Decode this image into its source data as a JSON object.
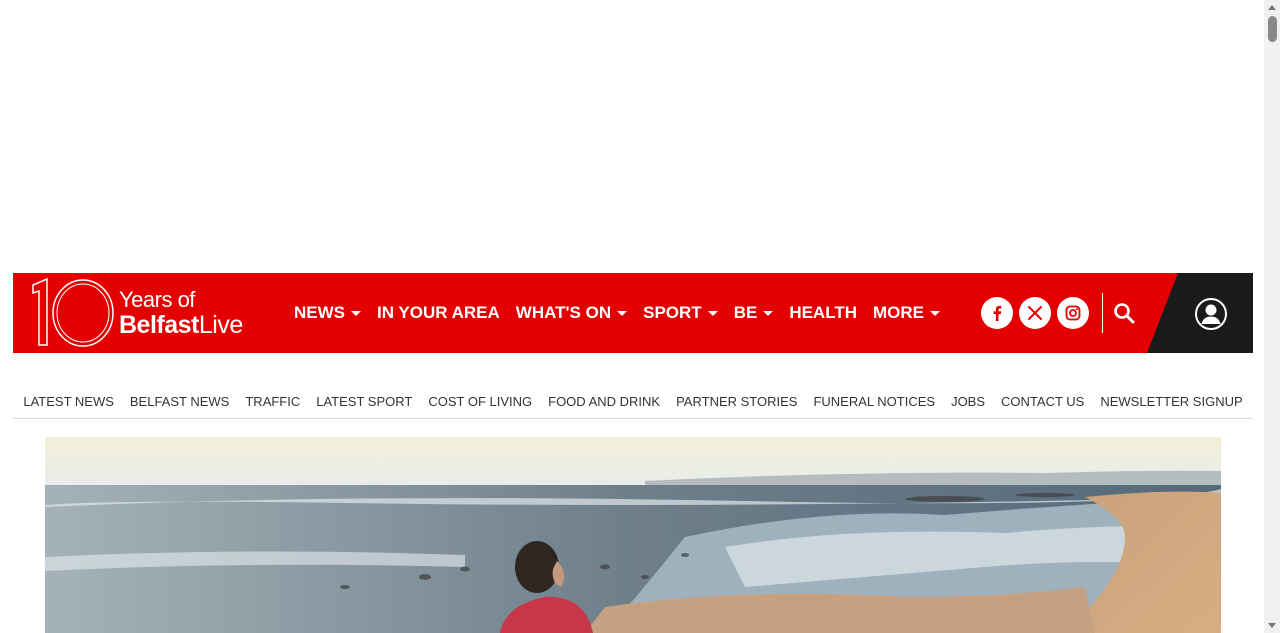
{
  "colors": {
    "brand_red": "#e40000",
    "account_bg": "#1a1a1a",
    "subnav_text": "#333333"
  },
  "logo": {
    "number": "10",
    "years_text": "Years of",
    "brand_bold": "Belfast",
    "brand_light": "Live"
  },
  "nav": {
    "items": [
      {
        "label": "NEWS",
        "has_dropdown": true
      },
      {
        "label": "IN YOUR AREA",
        "has_dropdown": false
      },
      {
        "label": "WHAT'S ON",
        "has_dropdown": true
      },
      {
        "label": "SPORT",
        "has_dropdown": true
      },
      {
        "label": "BE",
        "has_dropdown": true
      },
      {
        "label": "HEALTH",
        "has_dropdown": false
      },
      {
        "label": "MORE",
        "has_dropdown": true
      }
    ]
  },
  "social": {
    "icons": [
      "facebook-icon",
      "x-icon",
      "instagram-icon"
    ]
  },
  "header_actions": {
    "search_icon": "search-icon",
    "account_icon": "user-icon"
  },
  "subnav": {
    "items": [
      "LATEST NEWS",
      "BELFAST NEWS",
      "TRAFFIC",
      "LATEST SPORT",
      "COST OF LIVING",
      "FOOD AND DRINK",
      "PARTNER STORIES",
      "FUNERAL NOTICES",
      "JOBS",
      "CONTACT US",
      "NEWSLETTER SIGNUP"
    ]
  }
}
